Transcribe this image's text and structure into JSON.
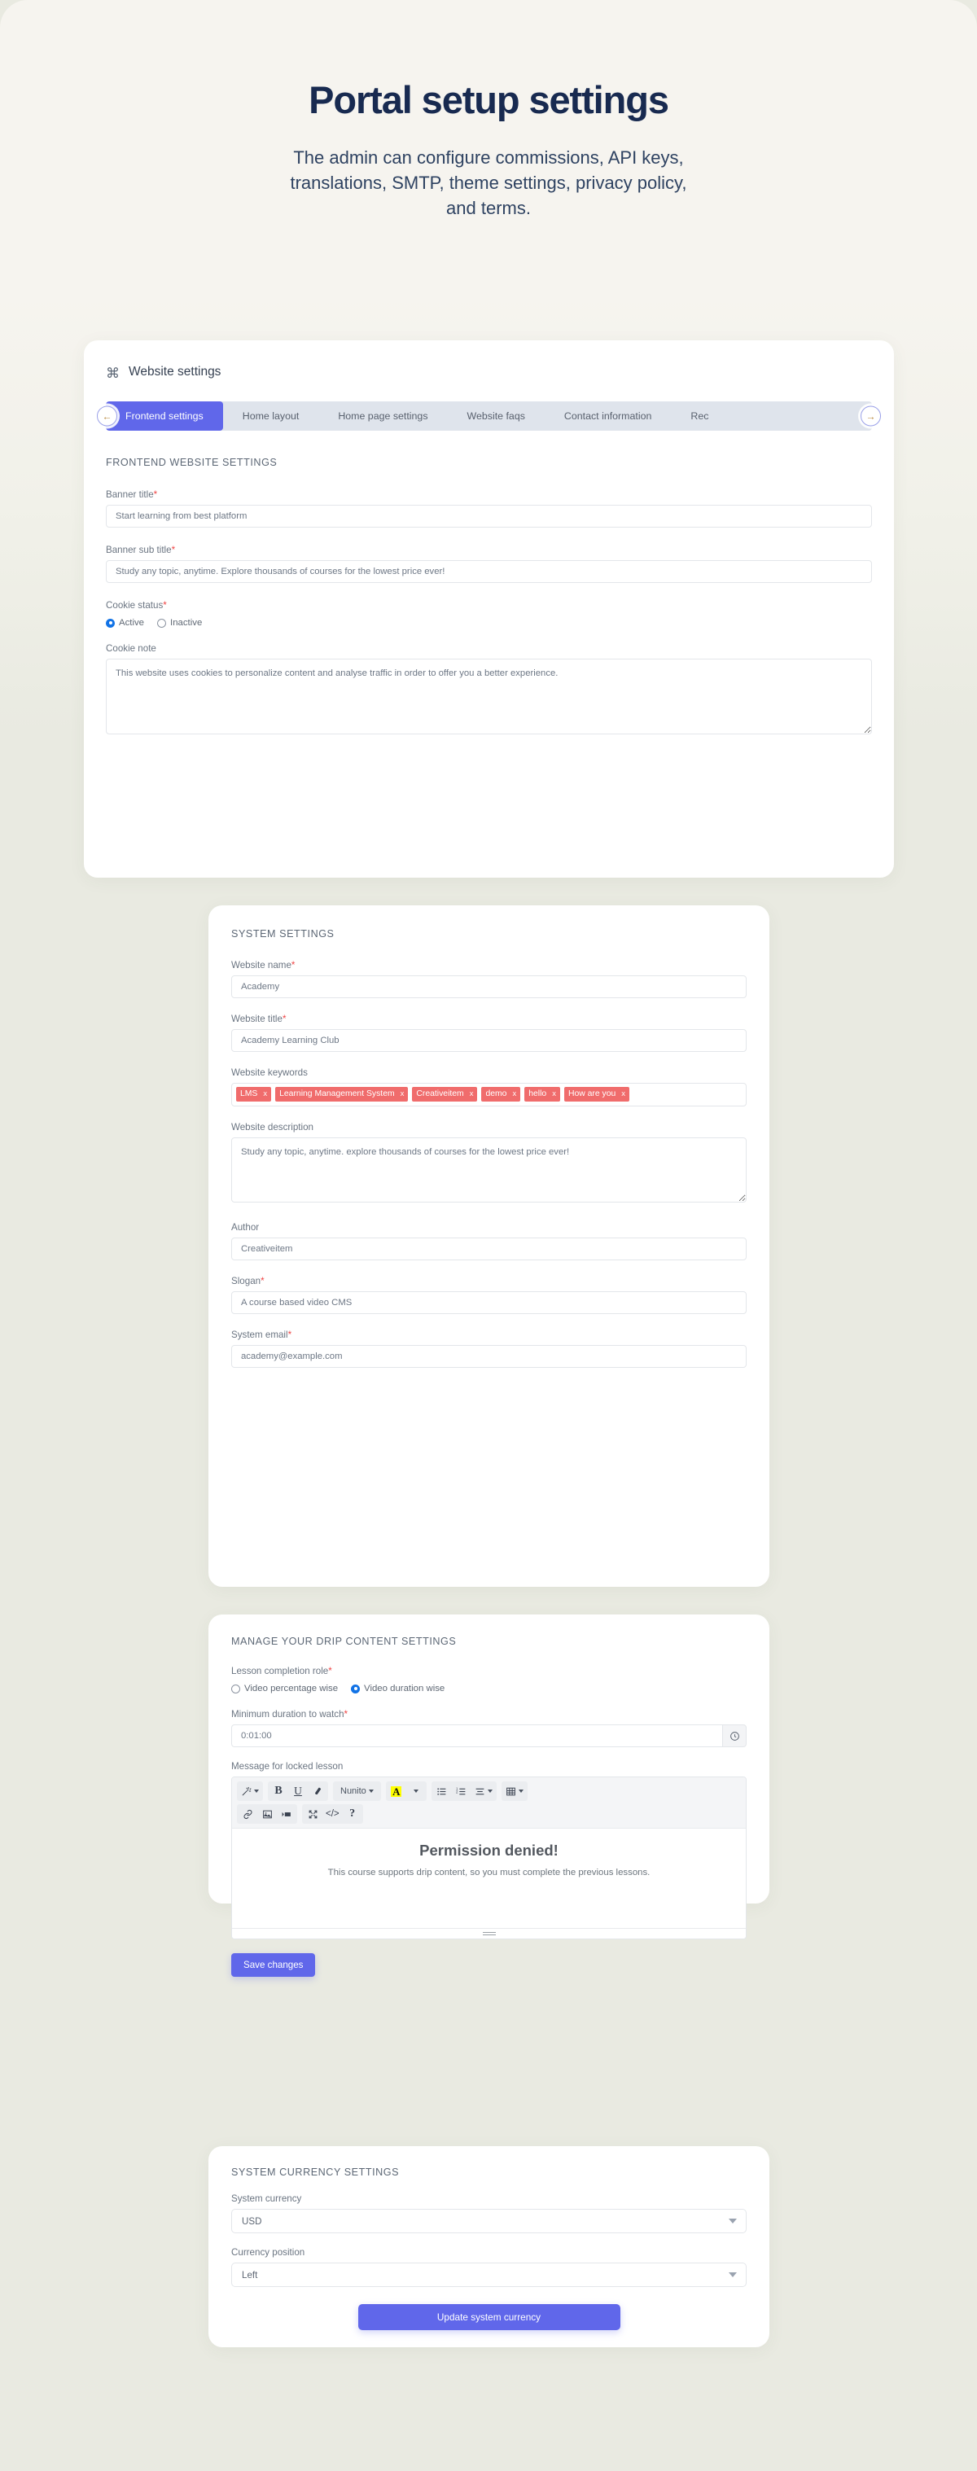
{
  "hero": {
    "title": "Portal setup settings",
    "subtitle": "The admin can configure commissions, API keys, translations, SMTP, theme settings, privacy policy, and terms."
  },
  "website_settings_card": {
    "header_icon": "command-icon",
    "header_title": "Website settings",
    "tabs": [
      {
        "label": "Frontend settings",
        "active": true
      },
      {
        "label": "Home layout",
        "active": false
      },
      {
        "label": "Home page settings",
        "active": false
      },
      {
        "label": "Website faqs",
        "active": false
      },
      {
        "label": "Contact information",
        "active": false
      },
      {
        "label": "Rec",
        "active": false
      }
    ],
    "tab_prev_icon": "arrow-left-icon",
    "tab_next_icon": "arrow-right-icon",
    "section_title": "FRONTEND WEBSITE SETTINGS",
    "fields": {
      "banner_title_label": "Banner title",
      "banner_title_value": "Start learning from best platform",
      "banner_subtitle_label": "Banner sub title",
      "banner_subtitle_value": "Study any topic, anytime. Explore thousands of courses for the lowest price ever!",
      "cookie_status_label": "Cookie status",
      "cookie_status_options": [
        "Active",
        "Inactive"
      ],
      "cookie_status_selected": "Active",
      "cookie_note_label": "Cookie note",
      "cookie_note_value": "This website uses cookies to personalize content and analyse traffic in order to offer you a better experience."
    }
  },
  "system_settings_card": {
    "section_title": "SYSTEM SETTINGS",
    "website_name_label": "Website name",
    "website_name_value": "Academy",
    "website_title_label": "Website title",
    "website_title_value": "Academy Learning Club",
    "website_keywords_label": "Website keywords",
    "website_keywords": [
      "LMS",
      "Learning Management System",
      "Creativeitem",
      "demo",
      "hello",
      "How are you"
    ],
    "tag_remove_label": "x",
    "website_description_label": "Website description",
    "website_description_value": "Study any topic, anytime. explore thousands of courses for the lowest price ever!",
    "author_label": "Author",
    "author_value": "Creativeitem",
    "slogan_label": "Slogan",
    "slogan_value": "A course based video CMS",
    "system_email_label": "System email",
    "system_email_value": "academy@example.com"
  },
  "drip_content_card": {
    "section_title": "MANAGE YOUR DRIP CONTENT SETTINGS",
    "lesson_completion_label": "Lesson completion role",
    "lesson_completion_options": [
      "Video percentage wise",
      "Video duration wise"
    ],
    "lesson_completion_selected": "Video duration wise",
    "min_duration_label": "Minimum duration to watch",
    "min_duration_value": "0:01:00",
    "clock_icon": "clock-icon",
    "message_label": "Message for locked lesson",
    "editor_toolbar_row1": [
      {
        "name": "magic-wand-icon",
        "label": ""
      },
      {
        "name": "bold-icon",
        "label": "B"
      },
      {
        "name": "underline-icon",
        "label": "U"
      },
      {
        "name": "eraser-icon",
        "label": ""
      },
      {
        "name": "font-family-select",
        "label": "Nunito"
      },
      {
        "name": "text-highlight-icon",
        "label": "A"
      },
      {
        "name": "unordered-list-icon",
        "label": ""
      },
      {
        "name": "ordered-list-icon",
        "label": ""
      },
      {
        "name": "align-icon",
        "label": ""
      },
      {
        "name": "table-icon",
        "label": ""
      }
    ],
    "editor_toolbar_row2": [
      {
        "name": "link-icon",
        "label": ""
      },
      {
        "name": "image-icon",
        "label": ""
      },
      {
        "name": "video-icon",
        "label": ""
      },
      {
        "name": "fullscreen-icon",
        "label": ""
      },
      {
        "name": "code-view-icon",
        "label": "</>"
      },
      {
        "name": "help-icon",
        "label": "?"
      }
    ],
    "editor_heading": "Permission denied!",
    "editor_paragraph": "This course supports drip content, so you must complete the previous lessons.",
    "save_label": "Save changes"
  },
  "currency_card": {
    "section_title": "SYSTEM CURRENCY SETTINGS",
    "system_currency_label": "System currency",
    "system_currency_value": "USD",
    "currency_position_label": "Currency position",
    "currency_position_value": "Left",
    "update_label": "Update system currency"
  },
  "colors": {
    "accent": "#6067ea",
    "tag": "#f06c6c",
    "radio_on": "#1273e6",
    "required": "#ef4444",
    "page_bg": "#e9eae1",
    "hero_bg": "#f6f4ef",
    "title": "#182a50"
  }
}
